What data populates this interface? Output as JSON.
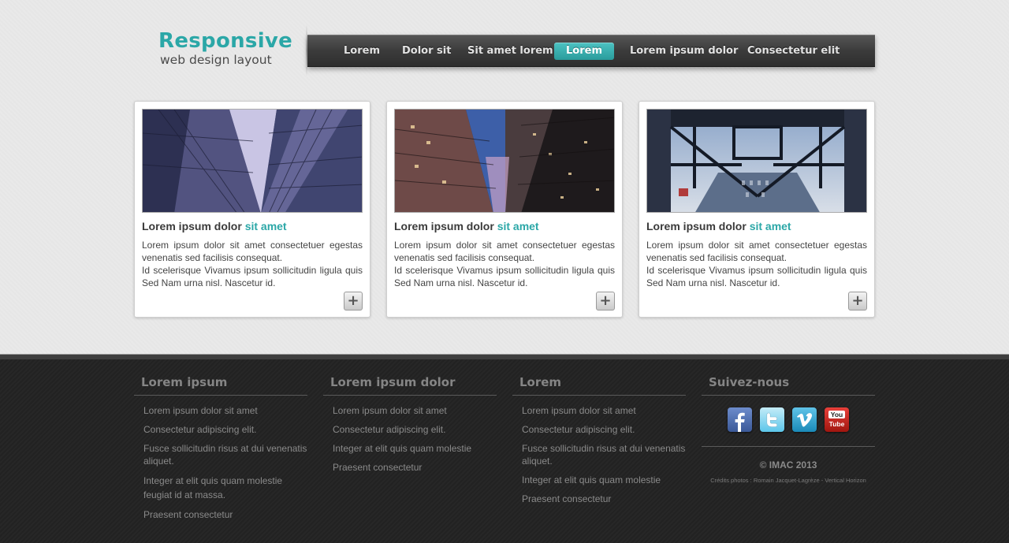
{
  "logo": {
    "title": "Responsive",
    "subtitle": "web design layout"
  },
  "nav": {
    "items": [
      {
        "label": "Lorem"
      },
      {
        "label": "Dolor sit"
      },
      {
        "label": "Sit amet lorem"
      },
      {
        "label": "Lorem"
      },
      {
        "label": "Lorem ipsum dolor"
      },
      {
        "label": "Consectetur elit"
      }
    ],
    "active_index": 3
  },
  "cards": [
    {
      "title": "Lorem ipsum dolor ",
      "title_accent": "sit amet",
      "text1": "Lorem ipsum dolor sit amet consectetuer egestas venenatis sed facilisis consequat.",
      "text2": "Id scelerisque Vivamus ipsum sollicitudin ligula quis Sed Nam urna nisl. Nascetur id.",
      "button": "+"
    },
    {
      "title": "Lorem ipsum dolor ",
      "title_accent": "sit amet",
      "text1": "Lorem ipsum dolor sit amet consectetuer egestas venenatis sed facilisis consequat.",
      "text2": "Id scelerisque Vivamus ipsum sollicitudin ligula quis Sed Nam urna nisl. Nascetur id.",
      "button": "+"
    },
    {
      "title": "Lorem ipsum dolor ",
      "title_accent": "sit amet",
      "text1": "Lorem ipsum dolor sit amet consectetuer egestas venenatis sed facilisis consequat.",
      "text2": "Id scelerisque Vivamus ipsum sollicitudin ligula quis Sed Nam urna nisl. Nascetur id.",
      "button": "+"
    }
  ],
  "footer": {
    "columns": [
      {
        "heading": "Lorem ipsum",
        "links": [
          "Lorem ipsum dolor sit amet",
          "Consectetur adipiscing elit.",
          "Fusce sollicitudin risus at dui venenatis aliquet.",
          "Integer at elit quis quam molestie feugiat id at massa.",
          "Praesent consectetur"
        ]
      },
      {
        "heading": "Lorem ipsum dolor",
        "links": [
          "Lorem ipsum dolor sit amet",
          "Consectetur adipiscing elit.",
          "Integer at elit quis quam molestie",
          "Praesent consectetur"
        ]
      },
      {
        "heading": "Lorem",
        "links": [
          "Lorem ipsum dolor sit amet",
          "Consectetur adipiscing elit.",
          "Fusce sollicitudin risus at dui venenatis aliquet.",
          "Integer at elit quis quam molestie",
          "Praesent consectetur"
        ]
      }
    ],
    "social": {
      "heading": "Suivez-nous",
      "icons": [
        "facebook-icon",
        "twitter-icon",
        "vimeo-icon",
        "youtube-icon"
      ],
      "youtube_text_1": "You",
      "youtube_text_2": "Tube",
      "copyright": "© IMAC 2013",
      "credits": "Crédits photos : Romain Jacquet-Lagrèze - Vertical Horizon"
    }
  },
  "colors": {
    "accent": "#2ba7a7",
    "footer_bg": "#232323",
    "nav_bg": "#3b3b3b"
  }
}
